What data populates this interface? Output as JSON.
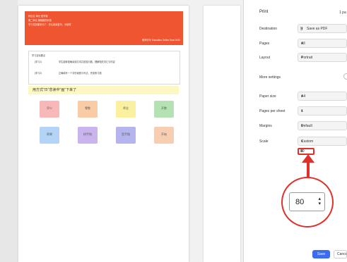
{
  "sidebar": {
    "title": "Print",
    "pages_count": "1 pa",
    "destination": {
      "label": "Destination",
      "value": "Save as PDF"
    },
    "pages": {
      "label": "Pages",
      "value": "All"
    },
    "layout": {
      "label": "Layout",
      "value": "Portrait"
    },
    "more_settings": "More settings",
    "paper_size": {
      "label": "Paper size",
      "value": "A4"
    },
    "pages_per_sheet": {
      "label": "Pages per sheet",
      "value": "1"
    },
    "margins": {
      "label": "Margins",
      "value": "Default"
    },
    "scale": {
      "label": "Scale",
      "value": "Custom",
      "custom_value": "80"
    },
    "save_label": "Save",
    "cancel_label": "Cance"
  },
  "zoom": {
    "value": "80"
  },
  "preview": {
    "banner": {
      "line1": "科目名·单元·型学案",
      "line2": "第二单元   课程题的示范",
      "line3": "学习任务要求分了：仿认真读答写，分读材",
      "footer": "教师学写 Education Online Grad 2022"
    },
    "section": {
      "heading": "学习目标要点",
      "row1_tag": "(学习1)",
      "row1_text": "学生能够准确阅读文本并回答问题，理解相关词汇与内容",
      "row2_tag": "(学习2)",
      "row2_text": "正确填写一个字的读音与写法，完成练习题"
    },
    "yellow_text": "用方式\"日\"念读中\"画\"下来了",
    "cards": [
      {
        "label": "早少",
        "color": "#f8b8b8"
      },
      {
        "label": "零数",
        "color": "#f9cca6"
      },
      {
        "label": "师业",
        "color": "#faf0a0"
      },
      {
        "label": "开数",
        "color": "#b5e2b5"
      },
      {
        "label": "帮果",
        "color": "#b3d4f6"
      },
      {
        "label": "树手指",
        "color": "#c9b4ee"
      },
      {
        "label": "型手指",
        "color": "#b5b4ee"
      },
      {
        "label": "开始",
        "color": "#f8ceb3"
      }
    ]
  },
  "accent_color": "#e0302a",
  "primary_button_color": "#3d6cf0"
}
